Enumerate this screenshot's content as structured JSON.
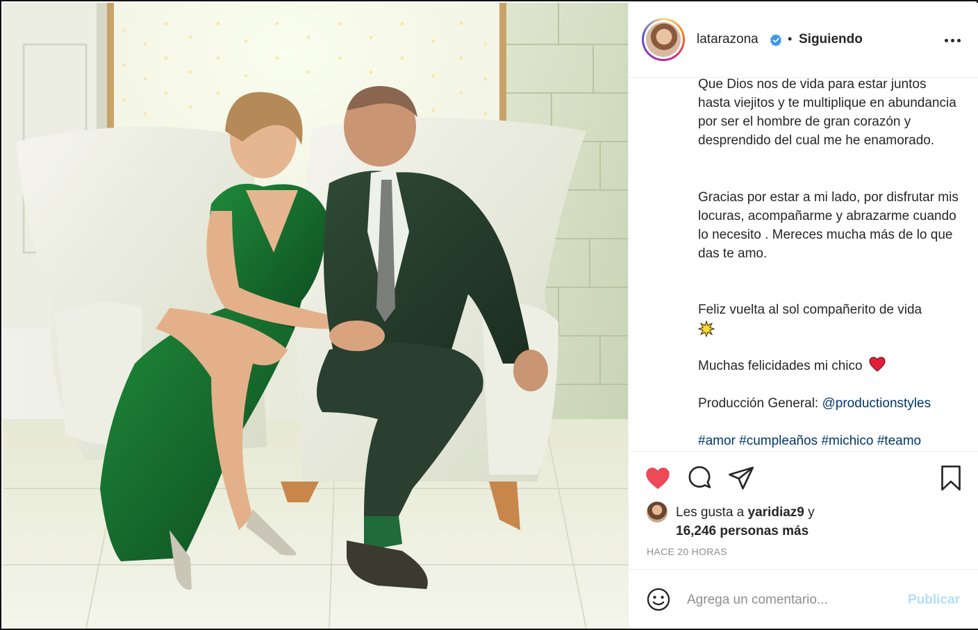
{
  "post": {
    "username": "latarazona",
    "separator": "•",
    "follow_state": "Siguiendo",
    "icons": {
      "avatar": "profile-avatar",
      "verified": "verified-badge-icon",
      "more": "more-options-icon"
    }
  },
  "caption": {
    "paragraph_1": "Que Dios nos de vida para estar juntos hasta viejitos y te multiplique en abundancia por ser el hombre de gran corazón y desprendido del cual me he enamorado.",
    "paragraph_2": "Gracias por estar a mi lado, por disfrutar mis locuras, acompañarme y abrazarme cuando lo necesito . Mereces mucha más de lo que das te amo.",
    "paragraph_3": "Feliz vuelta al sol compañerito de vida",
    "paragraph_3_emoji": "sun-emoji",
    "paragraph_4": "Muchas felicidades mi chico",
    "paragraph_4_emoji": "red-heart-emoji",
    "credit_label": "Producción General:",
    "credit_mention": "@productionstyles",
    "hashtags": [
      "#amor",
      "#cumpleaños",
      "#michico",
      "#teamo"
    ]
  },
  "actions": {
    "like_icon": "heart-filled-icon",
    "comment_icon": "comment-bubble-icon",
    "share_icon": "paper-plane-icon",
    "save_icon": "bookmark-icon",
    "like_color": "#ed4956"
  },
  "likes": {
    "prefix": "Les gusta a",
    "user": "yaridiaz9",
    "connector": "y",
    "count": "16,246 personas más"
  },
  "timestamp": "HACE 20 HORAS",
  "comment": {
    "placeholder": "Agrega un comentario...",
    "publish_label": "Publicar",
    "emoji_icon": "smiley-icon"
  },
  "colors": {
    "text": "#262626",
    "secondary": "#8e8e8e",
    "link": "#00376b",
    "publish_disabled": "#b2dffc"
  }
}
